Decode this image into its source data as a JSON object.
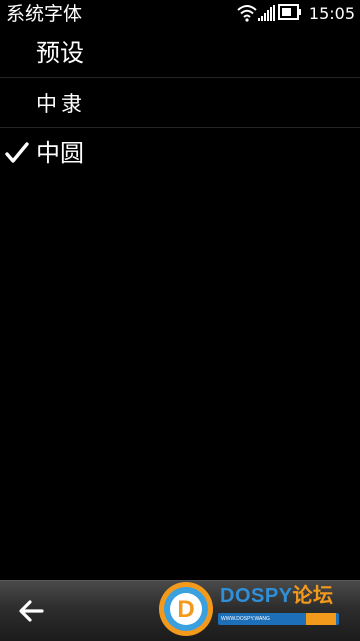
{
  "status_bar": {
    "title": "系统字体",
    "time": "15:05",
    "icons": [
      "wifi-icon",
      "signal-icon",
      "battery-icon"
    ]
  },
  "list": {
    "items": [
      {
        "label": "预设",
        "selected": false
      },
      {
        "label": "中隶",
        "selected": false
      },
      {
        "label": "中圆",
        "selected": true
      }
    ]
  },
  "toolbar": {
    "back_icon": "back-arrow-icon"
  },
  "watermark": {
    "title_latin": "DOSPY",
    "title_cn": "论坛",
    "subtitle": "WWW.DOSPY.WANG",
    "logo_letter": "D"
  },
  "colors": {
    "background": "#000000",
    "text": "#ffffff",
    "divider": "#242424",
    "toolbar_top": "#4a4a4a",
    "watermark_blue": "#2f8fd8",
    "watermark_orange": "#f39a1c"
  }
}
